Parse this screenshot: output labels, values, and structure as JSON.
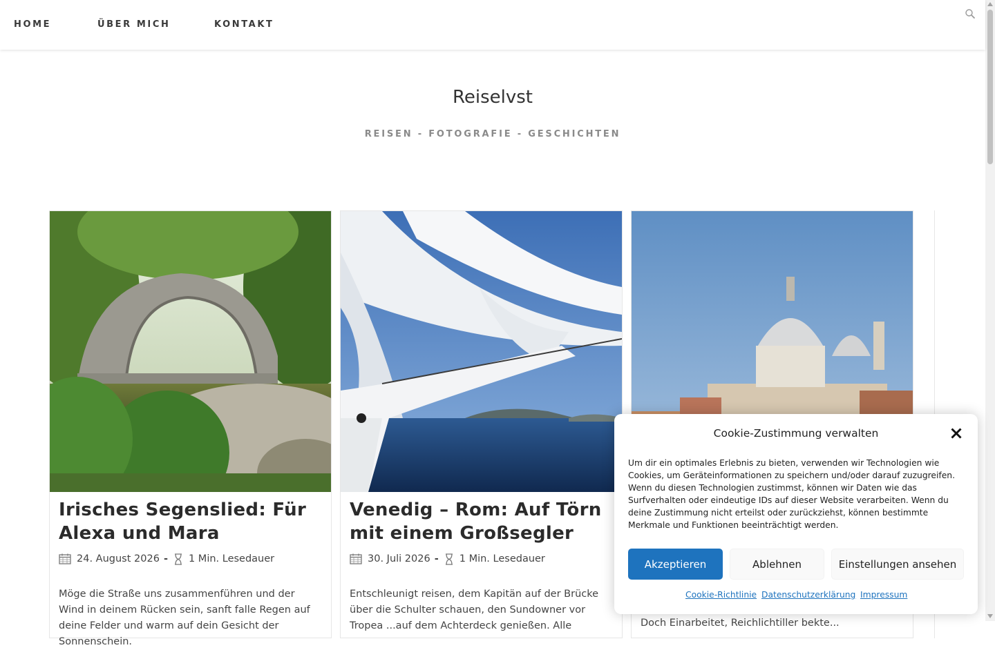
{
  "nav": {
    "items": [
      {
        "label": "HOME"
      },
      {
        "label": "ÜBER MICH"
      },
      {
        "label": "KONTAKT"
      }
    ],
    "search_icon": "search-icon"
  },
  "header": {
    "title": "Reiselvst",
    "tagline": "REISEN - FOTOGRAFIE - GESCHICHTEN"
  },
  "posts": [
    {
      "title": "Irisches Segenslied: Für Alexa und Mara",
      "date": "24. August 2026",
      "read_time": "1 Min. Lesedauer",
      "excerpt": "Möge die Straße uns zusammenführen und der Wind in deinem Rücken sein, sanft falle Regen auf deine Felder und warm auf dein Gesicht der Sonnenschein."
    },
    {
      "title": "Venedig – Rom: Auf Törn mit einem Großsegler",
      "date": "30. Juli 2026",
      "read_time": "1 Min. Lesedauer",
      "excerpt": "Entschleunigt reisen, dem Kapitän auf der Brücke über die Schulter schauen, den Sundowner vor Tropea ...auf dem Achterdeck genießen. Alle"
    },
    {
      "title": "",
      "excerpt": "Doch Einarbeitet, Reichlichtiller bekte..."
    }
  ],
  "separator": "-",
  "cookie": {
    "title": "Cookie-Zustimmung verwalten",
    "text": "Um dir ein optimales Erlebnis zu bieten, verwenden wir Technologien wie Cookies, um Geräteinformationen zu speichern und/oder darauf zuzugreifen. Wenn du diesen Technologien zustimmst, können wir Daten wie das Surfverhalten oder eindeutige IDs auf dieser Website verarbeiten. Wenn du deine Zustimmung nicht erteilst oder zurückziehst, können bestimmte Merkmale und Funktionen beeinträchtigt werden.",
    "accept": "Akzeptieren",
    "deny": "Ablehnen",
    "settings": "Einstellungen ansehen",
    "links": {
      "policy": "Cookie-Richtlinie",
      "privacy": "Datenschutzerklärung",
      "imprint": "Impressum"
    },
    "accent_color": "#1e73be"
  }
}
